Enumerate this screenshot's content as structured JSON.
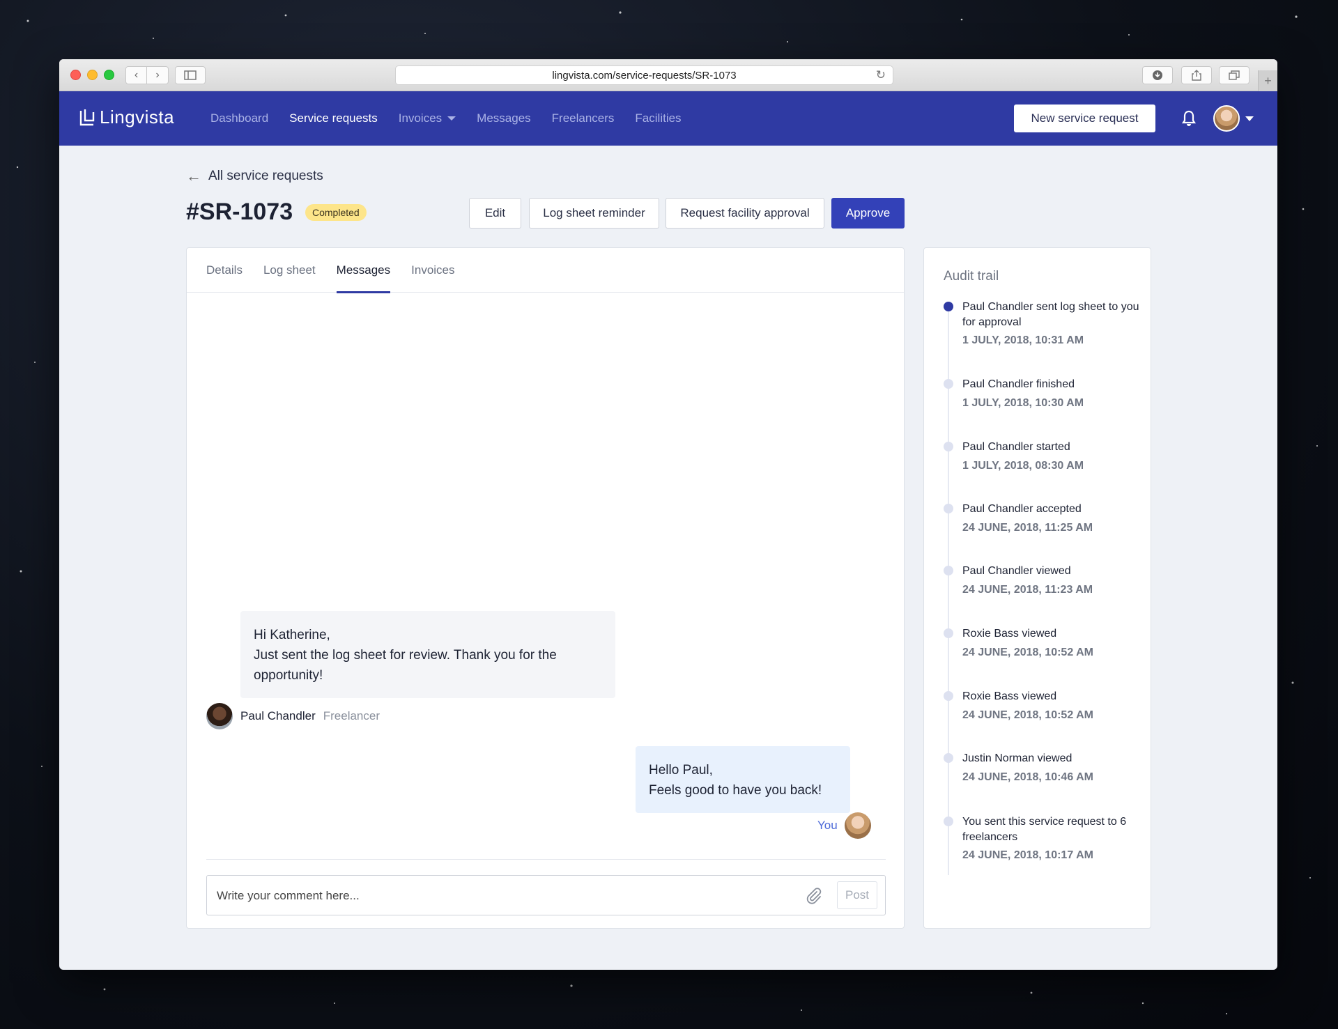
{
  "browser": {
    "url": "lingvista.com/service-requests/SR-1073"
  },
  "app": {
    "logo": "Lingvista",
    "nav": [
      {
        "label": "Dashboard"
      },
      {
        "label": "Service requests"
      },
      {
        "label": "Invoices"
      },
      {
        "label": "Messages"
      },
      {
        "label": "Freelancers"
      },
      {
        "label": "Facilities"
      }
    ],
    "new_request_label": "New service request"
  },
  "page": {
    "back_label": "All service requests",
    "title": "#SR-1073",
    "status": "Completed",
    "actions": {
      "edit": "Edit",
      "log_reminder": "Log sheet reminder",
      "facility_approval": "Request facility approval",
      "approve": "Approve"
    },
    "tabs": [
      {
        "label": "Details"
      },
      {
        "label": "Log sheet"
      },
      {
        "label": "Messages"
      },
      {
        "label": "Invoices"
      }
    ]
  },
  "messages": {
    "incoming": {
      "lines": [
        "Hi Katherine,",
        "Just sent the log sheet for review. Thank you for the opportunity!"
      ],
      "author": "Paul Chandler",
      "role": "Freelancer"
    },
    "outgoing": {
      "lines": [
        "Hello Paul,",
        "Feels good to have you back!"
      ],
      "author": "You"
    },
    "composer": {
      "placeholder": "Write your comment here...",
      "post_label": "Post"
    }
  },
  "audit": {
    "title": "Audit trail",
    "events": [
      {
        "text": "Paul Chandler sent log sheet to you for approval",
        "date": "1 JULY, 2018, 10:31 AM"
      },
      {
        "text": "Paul Chandler finished",
        "date": "1 JULY, 2018, 10:30 AM"
      },
      {
        "text": "Paul Chandler started",
        "date": "1 JULY, 2018, 08:30 AM"
      },
      {
        "text": "Paul Chandler accepted",
        "date": "24 JUNE, 2018, 11:25 AM"
      },
      {
        "text": "Paul Chandler viewed",
        "date": "24 JUNE, 2018, 11:23 AM"
      },
      {
        "text": "Roxie Bass viewed",
        "date": "24 JUNE, 2018, 10:52 AM"
      },
      {
        "text": "Roxie Bass viewed",
        "date": "24 JUNE, 2018, 10:52 AM"
      },
      {
        "text": "Justin Norman viewed",
        "date": "24 JUNE, 2018, 10:46 AM"
      },
      {
        "text": "You sent this service request to 6 freelancers",
        "date": "24 JUNE, 2018, 10:17 AM"
      }
    ]
  },
  "colors": {
    "brand": "#2f3aa3",
    "approve": "#3341b8",
    "badge": "#fde58a",
    "outgoing_bubble": "#e8f1fd"
  }
}
